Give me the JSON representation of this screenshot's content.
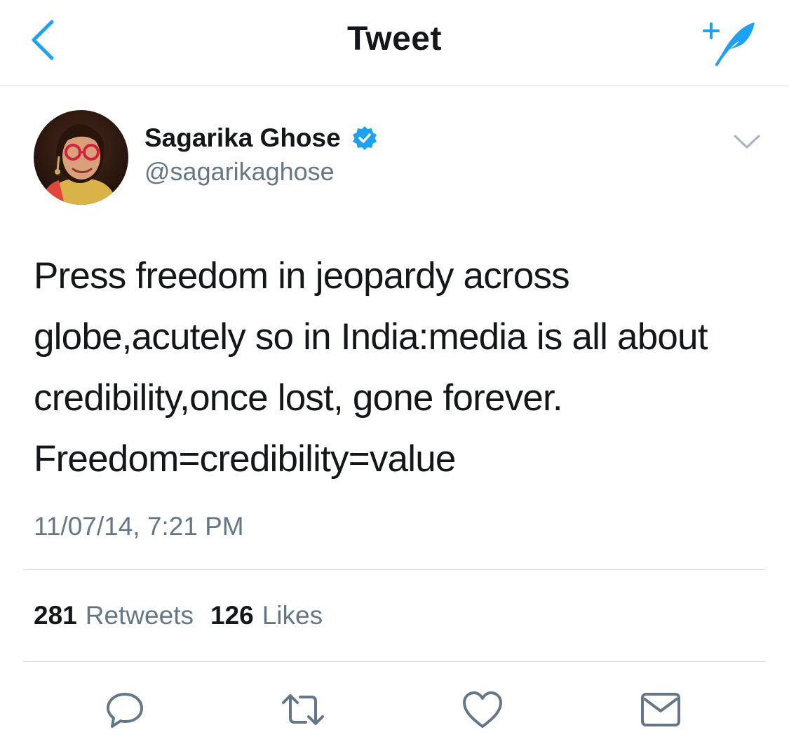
{
  "header": {
    "title": "Tweet",
    "back_icon": "chevron-left-icon",
    "compose_icon": "compose-tweet-feather-icon"
  },
  "author": {
    "name": "Sagarika Ghose",
    "handle": "@sagarikaghose",
    "verified": true
  },
  "tweet": {
    "lines": [
      "Press freedom in jeopardy across",
      "globe,acutely so in India:media is all about",
      "credibility,once lost, gone forever.",
      "Freedom=credibility=value"
    ],
    "timestamp": "11/07/14, 7:21 PM"
  },
  "stats": {
    "retweets_count": "281",
    "retweets_label": "Retweets",
    "likes_count": "126",
    "likes_label": "Likes"
  },
  "actions": [
    "reply-icon",
    "retweet-icon",
    "like-heart-icon",
    "share-envelope-icon"
  ],
  "colors": {
    "accent": "#1da1f2",
    "text": "#14171a",
    "secondary": "#657786",
    "divider": "#d6d6d6",
    "icon": "#657786"
  }
}
